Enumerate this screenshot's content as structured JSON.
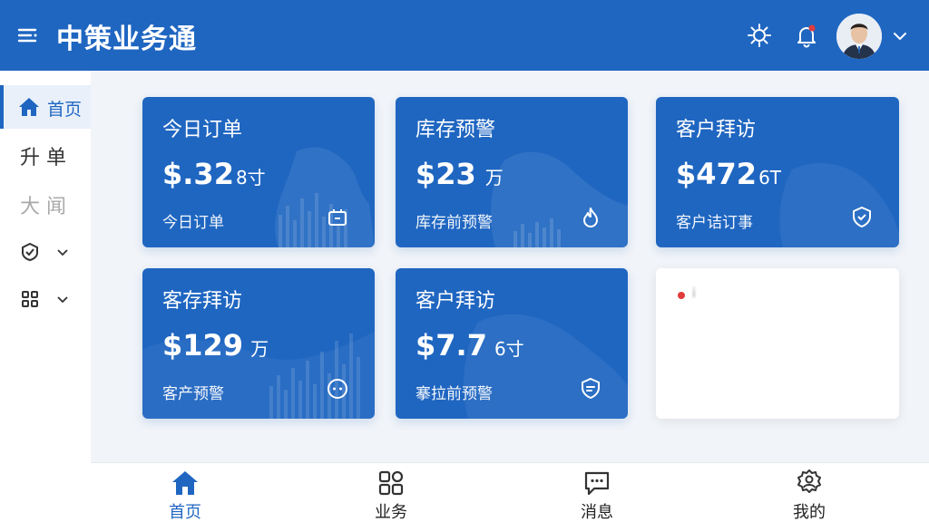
{
  "header": {
    "title": "中策业务通",
    "menu_icon": "menu-icon",
    "settings_icon": "gear-icon",
    "bell_icon": "bell-icon",
    "avatar_icon": "avatar",
    "caret_icon": "chevron-down-icon"
  },
  "sidebar": {
    "items": [
      {
        "label": "首页",
        "icon": "home-icon",
        "active": true
      },
      {
        "label": "升 单"
      },
      {
        "label": "大 闻"
      },
      {
        "icon": "shield-icon",
        "expand": "chevron-down-icon"
      },
      {
        "icon": "grid-icon",
        "expand": "chevron-down-icon"
      }
    ]
  },
  "cards": [
    {
      "title": "今日订单",
      "value": "$.32",
      "unit": "8寸",
      "sub": "今日订单",
      "icon": "bot-icon"
    },
    {
      "title": "库存预警",
      "value": "$23",
      "unit": "万",
      "sub": "库存前预警",
      "icon": "flame-icon"
    },
    {
      "title": "客户拜访",
      "value": "$472",
      "unit": "6T",
      "sub": "客户诘订事",
      "icon": "shield-check-icon"
    },
    {
      "title": "客存拜访",
      "value": "$129",
      "unit": "万",
      "sub": "客产预警",
      "icon": "smile-icon"
    },
    {
      "title": "客户拜访",
      "value": "$7.7",
      "unit": "6寸",
      "sub": "搴拉前预警",
      "icon": "shield-chat-icon"
    }
  ],
  "empty_card": {
    "text": "i"
  },
  "bottom_nav": {
    "items": [
      {
        "label": "首页",
        "icon": "home-icon",
        "active": true
      },
      {
        "label": "业务",
        "icon": "grid-icon"
      },
      {
        "label": "消息",
        "icon": "chat-icon"
      },
      {
        "label": "我的",
        "icon": "profile-icon"
      }
    ]
  },
  "colors": {
    "primary": "#1f66c1",
    "background": "#f1f4f8",
    "badge": "#e23b3b"
  }
}
